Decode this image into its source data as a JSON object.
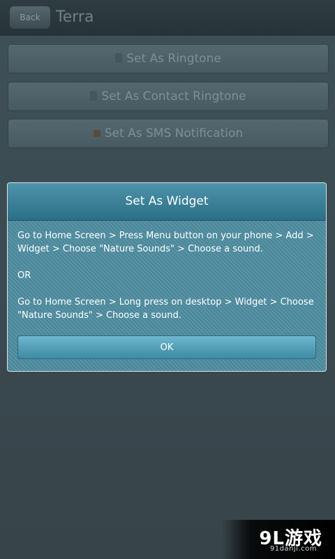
{
  "background": {
    "header": {
      "back_label": "Back",
      "title": "Terra"
    },
    "buttons": [
      {
        "label": "Set As Ringtone",
        "icon": "phone-icon"
      },
      {
        "label": "Set As Contact Ringtone",
        "icon": "contact-icon"
      },
      {
        "label": "Set As SMS Notification",
        "icon": "envelope-icon"
      }
    ]
  },
  "dialog": {
    "title": "Set As Widget",
    "paragraphs": [
      "Go to Home Screen > Press Menu button on your phone > Add > Widget > Choose \"Nature Sounds\" > Choose a sound.",
      "OR",
      "Go to Home Screen > Long press on desktop > Widget > Choose \"Nature Sounds\" > Choose a sound."
    ],
    "ok_label": "OK"
  },
  "watermark": {
    "logo": "9L游戏",
    "url": "91danji.com"
  },
  "colors": {
    "dialog_header": "#2c6f86",
    "dialog_body": "#4f8ea1",
    "ok_button": "#3d8aa3"
  }
}
